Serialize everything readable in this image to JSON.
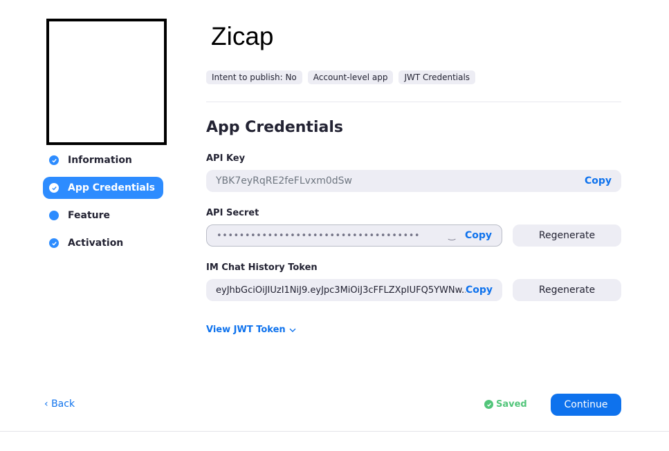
{
  "app": {
    "title": "Zicap",
    "tags": [
      "Intent to publish: No",
      "Account-level app",
      "JWT Credentials"
    ]
  },
  "steps": [
    {
      "label": "Information",
      "state": "completed"
    },
    {
      "label": "App Credentials",
      "state": "active"
    },
    {
      "label": "Feature",
      "state": "incomplete"
    },
    {
      "label": "Activation",
      "state": "completed"
    }
  ],
  "credentials": {
    "section_title": "App Credentials",
    "api_key": {
      "label": "API Key",
      "value": "YBK7eyRqRE2feFLvxm0dSw",
      "copy_label": "Copy"
    },
    "api_secret": {
      "label": "API Secret",
      "value": "••••••••••••••••••••••••••••••••••••",
      "copy_label": "Copy",
      "regenerate_label": "Regenerate"
    },
    "im_token": {
      "label": "IM Chat History Token",
      "value": "eyJhbGciOiJIUzI1NiJ9.eyJpc3MiOiJ3cFFLZXpIUFQ5YWNw...",
      "copy_label": "Copy",
      "regenerate_label": "Regenerate"
    },
    "view_jwt_label": "View JWT Token"
  },
  "footer": {
    "back_label": "Back",
    "saved_label": "Saved",
    "continue_label": "Continue"
  },
  "colors": {
    "accent": "#0e72ed",
    "step_active": "#2d8cff",
    "saved": "#52c57a"
  }
}
